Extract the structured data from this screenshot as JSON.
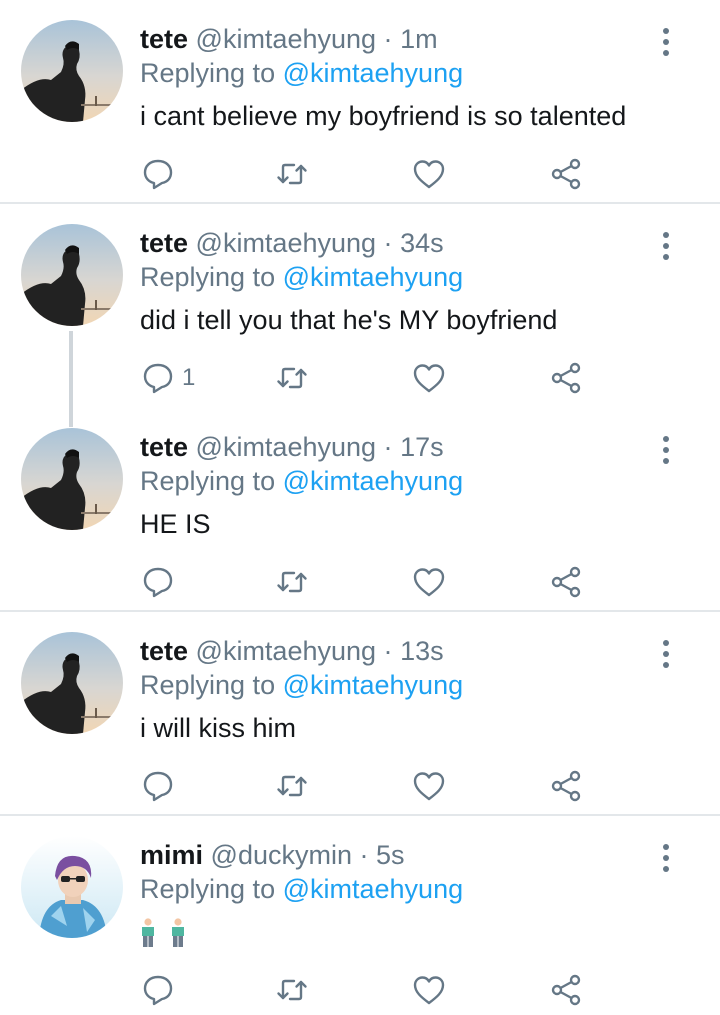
{
  "replying_label": "Replying to",
  "tweets": [
    {
      "name": "tete",
      "handle": "@kimtaehyung",
      "sep": "·",
      "time": "1m",
      "reply_to": "@kimtaehyung",
      "text": "i cant believe my boyfriend is so talented",
      "reply_count": ""
    },
    {
      "name": "tete",
      "handle": "@kimtaehyung",
      "sep": "·",
      "time": "34s",
      "reply_to": "@kimtaehyung",
      "text": "did i tell you that he's MY boyfriend",
      "reply_count": "1"
    },
    {
      "name": "tete",
      "handle": "@kimtaehyung",
      "sep": "·",
      "time": "17s",
      "reply_to": "@kimtaehyung",
      "text": "HE IS",
      "reply_count": ""
    },
    {
      "name": "tete",
      "handle": "@kimtaehyung",
      "sep": "·",
      "time": "13s",
      "reply_to": "@kimtaehyung",
      "text": "i will kiss him",
      "reply_count": ""
    },
    {
      "name": "mimi",
      "handle": "@duckymin",
      "sep": "·",
      "time": "5s",
      "reply_to": "@kimtaehyung",
      "text": "",
      "reply_count": ""
    }
  ],
  "icons": {
    "reply": "reply-icon",
    "retweet": "retweet-icon",
    "like": "heart-icon",
    "share": "share-icon",
    "more": "more-vertical-icon"
  },
  "colors": {
    "link": "#1da1f2",
    "secondary_text": "#657786",
    "primary_text": "#14171a",
    "divider": "#e3e7ea"
  }
}
